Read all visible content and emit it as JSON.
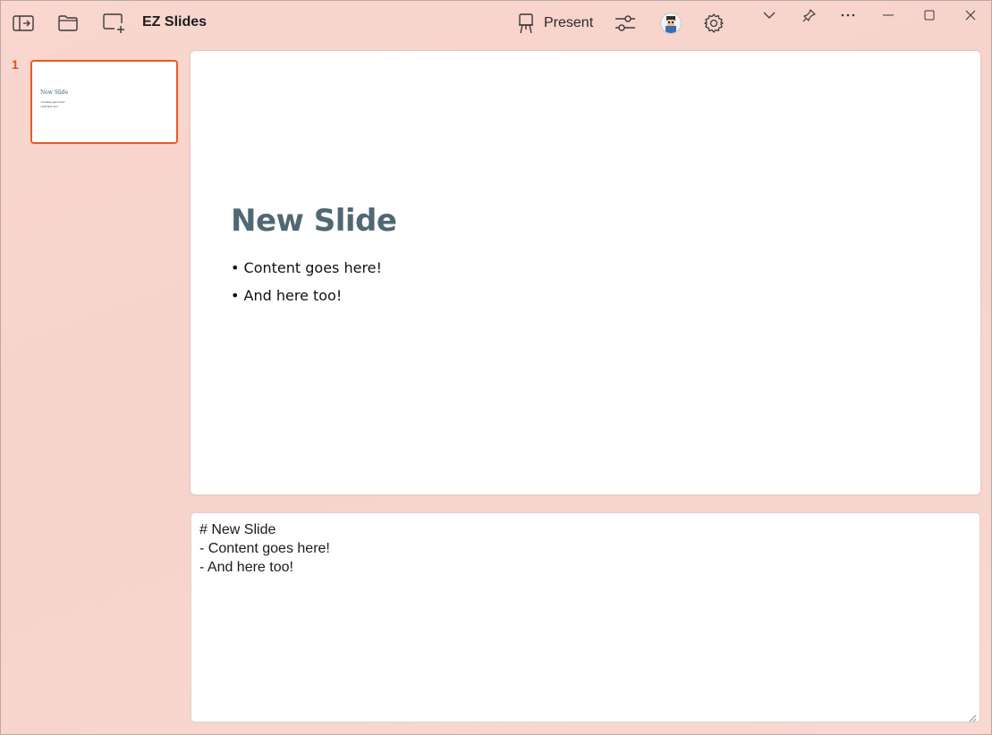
{
  "titlebar": {
    "app_title": "EZ Slides",
    "present_label": "Present",
    "icons": [
      "sidebar-toggle-icon",
      "folder-icon",
      "new-slide-icon",
      "present-easel-icon",
      "sliders-icon",
      "avatar",
      "gear-icon",
      "chevron-down-icon",
      "pin-icon",
      "more-icon",
      "minimize-icon",
      "maximize-icon",
      "close-icon"
    ]
  },
  "sidebar": {
    "slides": [
      {
        "number": "1",
        "title": "New Slide",
        "bullets": [
          "• Content goes here!",
          "• And here too!"
        ]
      }
    ]
  },
  "preview": {
    "title": "New Slide",
    "bullets": [
      "• Content goes here!",
      "• And here too!"
    ]
  },
  "editor": {
    "lines": [
      "# New Slide",
      "- Content goes here!",
      "- And here too!"
    ]
  },
  "colors": {
    "accent": "#e85a24",
    "background": "#f8d6ce",
    "slide_title": "#506873"
  }
}
